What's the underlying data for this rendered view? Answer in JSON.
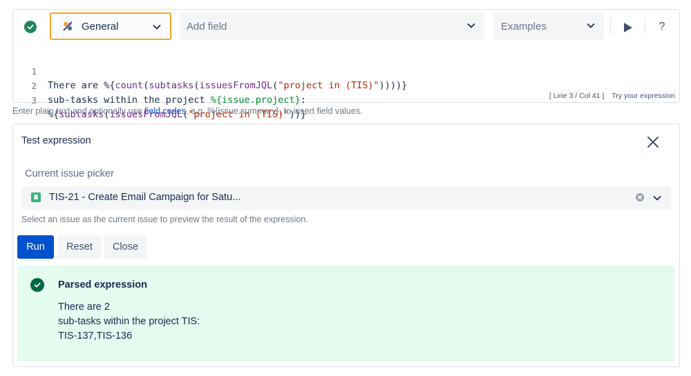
{
  "toolbar": {
    "general_label": "General",
    "field_placeholder": "Add field",
    "examples_label": "Examples",
    "help_label": "?"
  },
  "editor": {
    "line_numbers": [
      "1",
      "2",
      "3"
    ],
    "lines": [
      [
        "There are %{",
        "count",
        "(",
        "subtasks",
        "(",
        "issuesFromJQL",
        "(",
        "\"project in (TIS)\"",
        "))))}"
      ],
      [
        "sub-tasks within the project ",
        "%{issue.project}",
        ":"
      ],
      [
        "%{",
        "subtasks",
        "(",
        "issuesFromJQL",
        "(",
        "\"project in (TIS)\"",
        "))}"
      ]
    ],
    "cursor_position": "[ Line 3 / Col 41 ]",
    "try_label": "Try your expression"
  },
  "helper": {
    "prefix": "Enter plain text and optionally use ",
    "link": "field codes",
    "suffix": ", e.g. %{issue.summary}, to insert field values."
  },
  "test_panel": {
    "title": "Test expression",
    "picker_label": "Current issue picker",
    "picker_value": "TIS-21 - Create Email Campaign for Satu...",
    "picker_help": "Select an issue as the current issue to preview the result of the expression.",
    "run_label": "Run",
    "reset_label": "Reset",
    "close_label": "Close"
  },
  "result": {
    "title": "Parsed expression",
    "lines": [
      "There are 2",
      "sub-tasks within the project TIS:",
      "TIS-137,TIS-136"
    ]
  },
  "colors": {
    "accent": "#0052cc",
    "success": "#1f845a",
    "highlight_border": "#f5a623",
    "result_bg": "#e3fcef"
  }
}
